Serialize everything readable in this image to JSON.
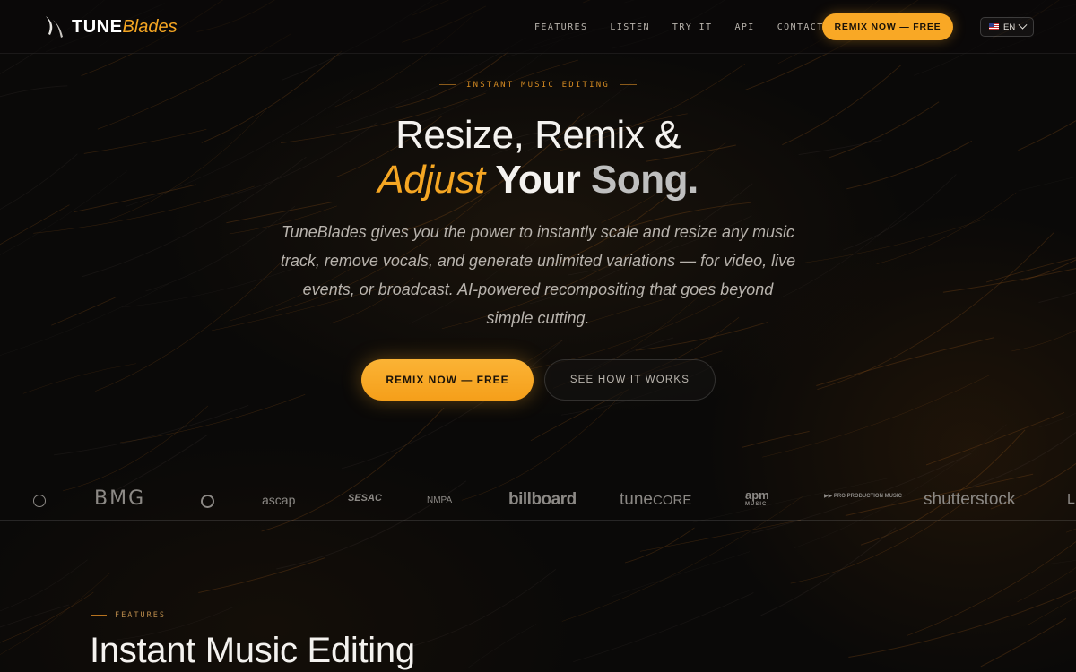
{
  "brand": {
    "name_strong": "TUNE",
    "name_italic": "Blades"
  },
  "nav": {
    "items": [
      "FEATURES",
      "LISTEN",
      "TRY IT",
      "API",
      "CONTACT"
    ],
    "cta_label": "REMIX NOW — FREE",
    "language": "EN"
  },
  "hero": {
    "eyebrow": "INSTANT MUSIC EDITING",
    "title_line1": "Resize, Remix &",
    "title_adjust": "Adjust",
    "title_your": "Your",
    "title_song": "Song.",
    "subtitle": "TuneBlades gives you the power to instantly scale and resize any music track, remove vocals, and generate unlimited variations — for video, live events, or broadcast. AI-powered recompositing that goes beyond simple cutting.",
    "primary_cta": "REMIX NOW — FREE",
    "secondary_cta": "SEE HOW IT WORKS"
  },
  "partners": {
    "bmg": "BMG",
    "ascap": "ascap",
    "sesac": "SESAC",
    "nmpa": "NMPA",
    "billboard": "billboard",
    "tunecore_a": "tune",
    "tunecore_b": "CORE",
    "apm_top": "apm",
    "apm_sub": "MUSIC",
    "ppm": "PRO PRODUCTION MUSIC",
    "shutterstock": "shutterstock",
    "cut": "L"
  },
  "features": {
    "eyebrow": "FEATURES",
    "title": "Instant Music Editing"
  },
  "colors": {
    "accent": "#f9a825",
    "background": "#0a0908"
  }
}
